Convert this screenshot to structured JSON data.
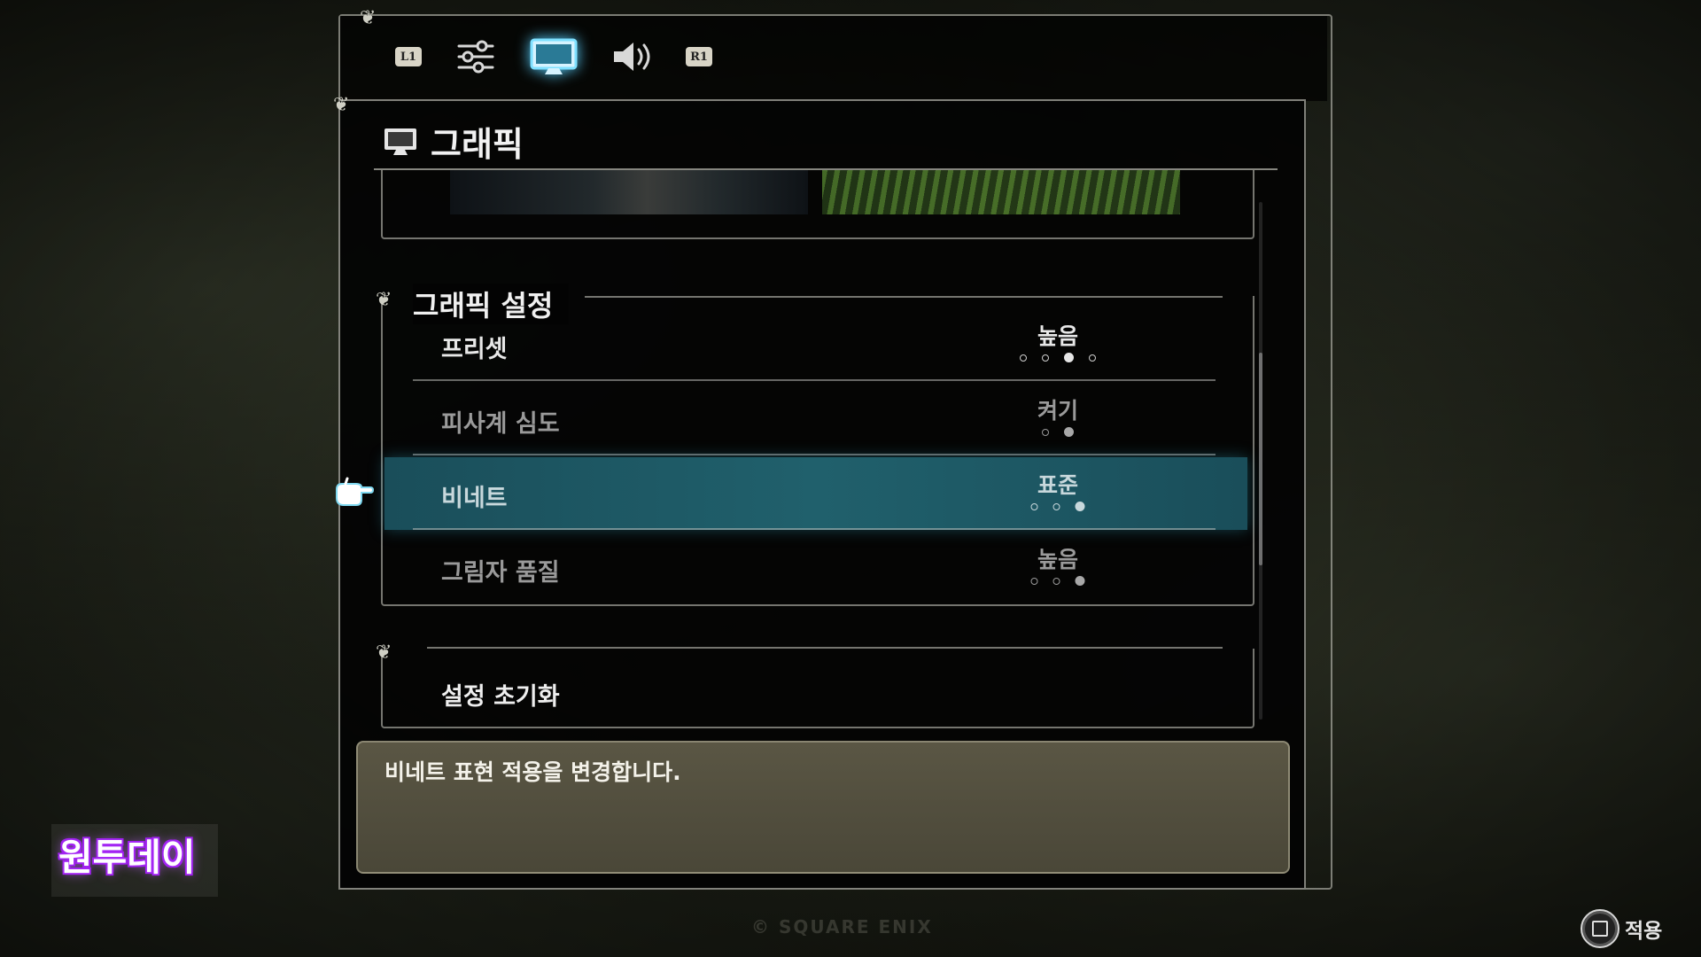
{
  "tabs": {
    "left_bumper": "L1",
    "right_bumper": "R1",
    "items": [
      {
        "icon": "sliders-icon",
        "active": false
      },
      {
        "icon": "monitor-icon",
        "active": true
      },
      {
        "icon": "speaker-icon",
        "active": false
      }
    ]
  },
  "page": {
    "title": "그래픽",
    "title_icon": "monitor-icon"
  },
  "section": {
    "heading": "그래픽 설정",
    "rows": [
      {
        "label": "프리셋",
        "value": "높음",
        "options": 4,
        "selected_index": 2,
        "selected": false,
        "dim": false
      },
      {
        "label": "피사계 심도",
        "value": "켜기",
        "options": 2,
        "selected_index": 1,
        "selected": false,
        "dim": true
      },
      {
        "label": "비네트",
        "value": "표준",
        "options": 3,
        "selected_index": 2,
        "selected": true,
        "dim": false
      },
      {
        "label": "그림자 품질",
        "value": "높음",
        "options": 3,
        "selected_index": 2,
        "selected": false,
        "dim": true
      }
    ]
  },
  "reset": {
    "label": "설정 초기화"
  },
  "description": {
    "text": "비네트 표현 적용을 변경합니다."
  },
  "watermark": {
    "text": "원투데이"
  },
  "copyright": {
    "text": "© SQUARE ENIX"
  },
  "footer": {
    "apply_label": "적용",
    "apply_icon": "square-button-icon"
  },
  "colors": {
    "selected_row": "#20606c",
    "tab_glow": "#58d0ff",
    "description_bg": "#5a5644",
    "watermark_outline": "#a020f0"
  }
}
